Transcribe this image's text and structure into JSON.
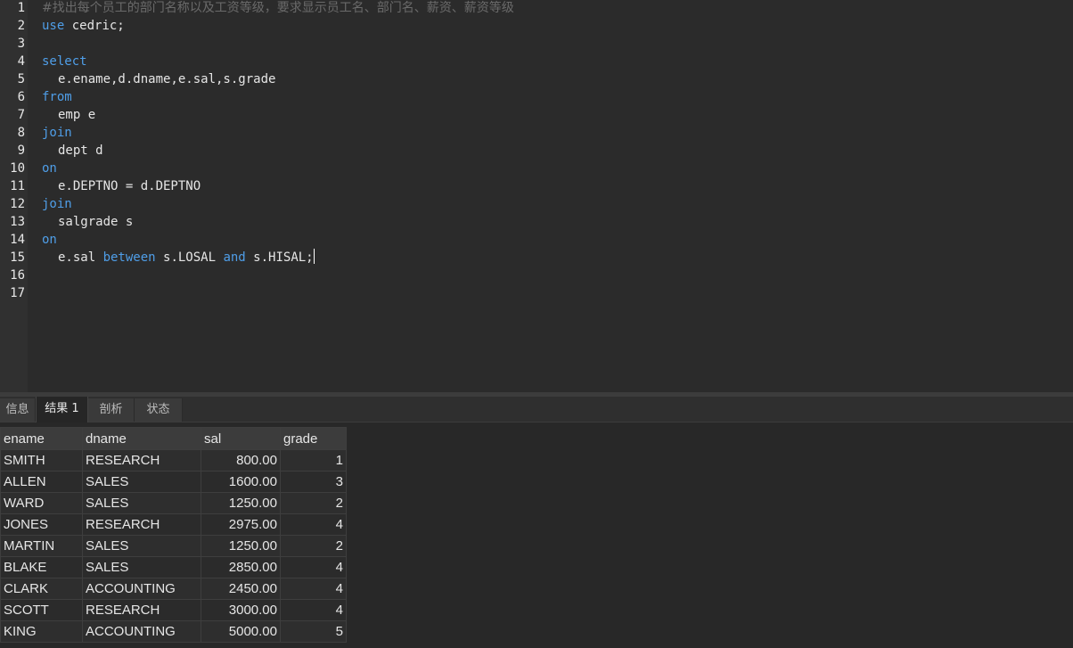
{
  "editor": {
    "line_numbers": [
      "1",
      "2",
      "3",
      "4",
      "5",
      "6",
      "7",
      "8",
      "9",
      "10",
      "11",
      "12",
      "13",
      "14",
      "15",
      "16",
      "17"
    ],
    "lines": {
      "l1": "#找出每个员工的部门名称以及工资等级，要求显示员工名、部门名、薪资、薪资等级",
      "l2_kw": "use",
      "l2_txt": " cedric;",
      "l4_kw": "select",
      "l5_txt": "e.ename,d.dname,e.sal,s.grade",
      "l6_kw": "from",
      "l7_txt": "emp e",
      "l8_kw": "join",
      "l9_txt": "dept d",
      "l10_kw": "on",
      "l11_txt": "e.DEPTNO = d.DEPTNO",
      "l12_kw": "join",
      "l13_txt": "salgrade s",
      "l14_kw": "on",
      "l15_a": "e.sal ",
      "l15_b": "between",
      "l15_c": " s.LOSAL ",
      "l15_d": "and",
      "l15_e": " s.HISAL;"
    }
  },
  "tabs": {
    "info": "信息",
    "result1": "结果 1",
    "profile": "剖析",
    "status": "状态"
  },
  "results": {
    "columns": [
      "ename",
      "dname",
      "sal",
      "grade"
    ],
    "rows": [
      [
        "SMITH",
        "RESEARCH",
        "800.00",
        "1"
      ],
      [
        "ALLEN",
        "SALES",
        "1600.00",
        "3"
      ],
      [
        "WARD",
        "SALES",
        "1250.00",
        "2"
      ],
      [
        "JONES",
        "RESEARCH",
        "2975.00",
        "4"
      ],
      [
        "MARTIN",
        "SALES",
        "1250.00",
        "2"
      ],
      [
        "BLAKE",
        "SALES",
        "2850.00",
        "4"
      ],
      [
        "CLARK",
        "ACCOUNTING",
        "2450.00",
        "4"
      ],
      [
        "SCOTT",
        "RESEARCH",
        "3000.00",
        "4"
      ],
      [
        "KING",
        "ACCOUNTING",
        "5000.00",
        "5"
      ]
    ]
  },
  "colors": {
    "keyword": "#4f9ee8",
    "comment": "#6a6a6a",
    "background": "#2b2b2b"
  }
}
